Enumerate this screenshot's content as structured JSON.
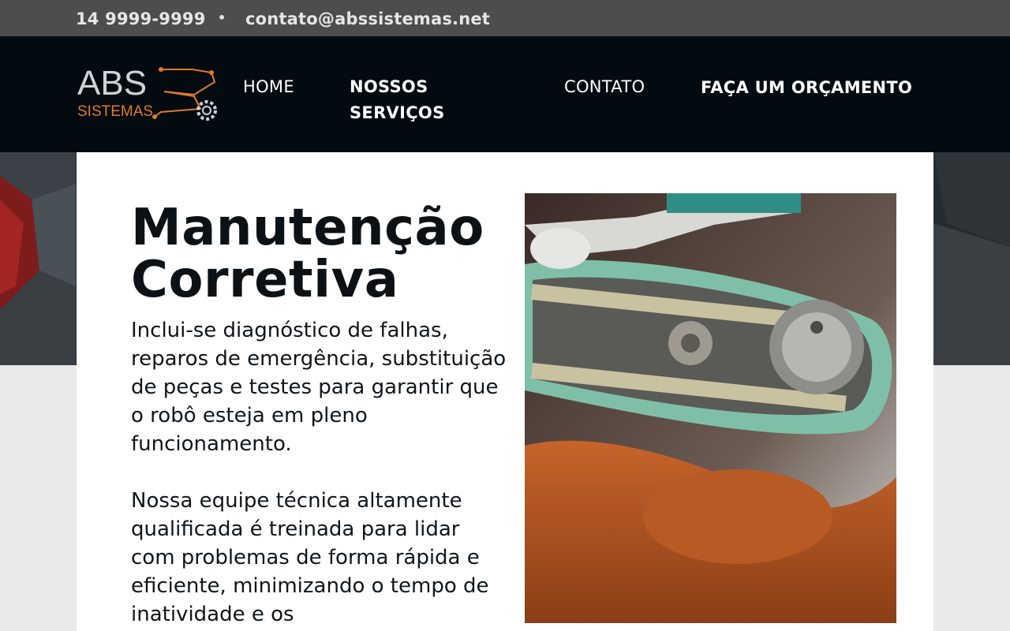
{
  "topbar": {
    "phone": "14 9999-9999",
    "separator": "•",
    "email": "contato@abssistemas.net"
  },
  "logo": {
    "text_top": "ABS",
    "text_bottom": "SISTEMAS"
  },
  "nav": {
    "home": "HOME",
    "servicos_line1": "NOSSOS",
    "servicos_line2": "SERVIÇOS",
    "contato": "CONTATO",
    "orcamento": "FAÇA UM ORÇAMENTO"
  },
  "content": {
    "title_line1": "Manutenção",
    "title_line2": "Corretiva",
    "paragraph1": "Inclui-se diagnóstico de falhas, reparos de emergência, substituição de peças e testes para garantir que o robô esteja em pleno funcionamento.",
    "paragraph2": "Nossa equipe técnica altamente qualificada é treinada para lidar com problemas de forma rápida e eficiente, minimizando o tempo de inatividade e os"
  },
  "colors": {
    "topbar_bg": "#4d4d4d",
    "navbar_bg": "#030b10",
    "logo_accent": "#e07a2e",
    "logo_gray": "#cfd3d6"
  }
}
